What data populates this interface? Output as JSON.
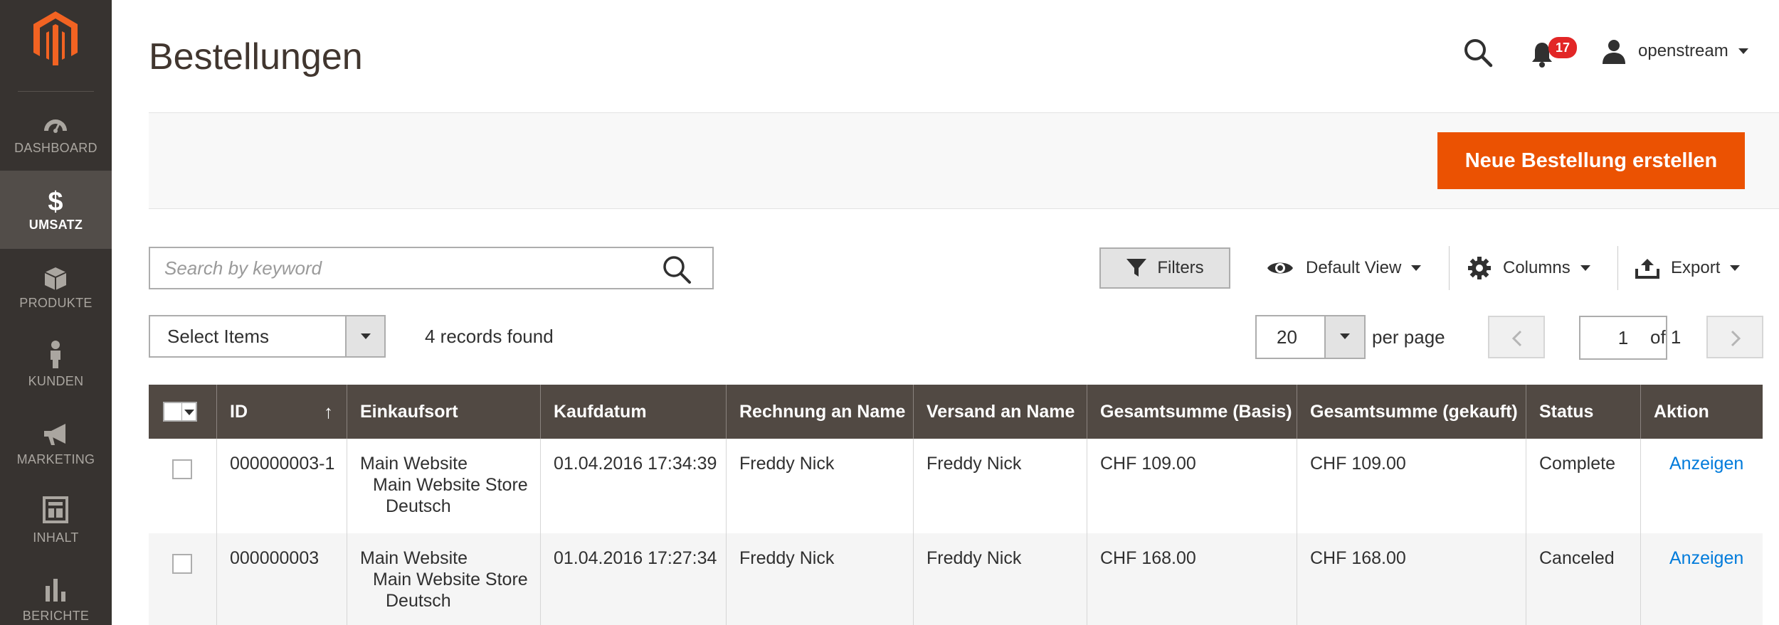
{
  "sidebar": {
    "items": [
      {
        "label": "DASHBOARD",
        "icon": "dashboard-icon"
      },
      {
        "label": "UMSATZ",
        "icon": "dollar-icon",
        "active": true
      },
      {
        "label": "PRODUKTE",
        "icon": "box-icon"
      },
      {
        "label": "KUNDEN",
        "icon": "person-icon"
      },
      {
        "label": "MARKETING",
        "icon": "megaphone-icon"
      },
      {
        "label": "INHALT",
        "icon": "layout-icon"
      },
      {
        "label": "BERICHTE",
        "icon": "bar-chart-icon"
      }
    ]
  },
  "header": {
    "title": "Bestellungen",
    "notifications_count": "17",
    "user_name": "openstream"
  },
  "actions": {
    "primary_label": "Neue Bestellung erstellen"
  },
  "toolbar": {
    "search_placeholder": "Search by keyword",
    "filters_label": "Filters",
    "view_label": "Default View",
    "columns_label": "Columns",
    "export_label": "Export",
    "mass_action_label": "Select Items",
    "records_found": "4 records found",
    "per_page_value": "20",
    "per_page_label": "per page",
    "current_page": "1",
    "page_of": "of 1"
  },
  "grid": {
    "columns": [
      "ID",
      "Einkaufsort",
      "Kaufdatum",
      "Rechnung an Name",
      "Versand an Name",
      "Gesamtsumme (Basis)",
      "Gesamtsumme (gekauft)",
      "Status",
      "Aktion"
    ],
    "rows": [
      {
        "id": "000000003-1",
        "store": [
          "Main Website",
          "Main Website Store",
          "Deutsch"
        ],
        "date": "01.04.2016 17:34:39",
        "bill_to": "Freddy Nick",
        "ship_to": "Freddy Nick",
        "total_base": "CHF 109.00",
        "total_purchased": "CHF 109.00",
        "status": "Complete",
        "action": "Anzeigen"
      },
      {
        "id": "000000003",
        "store": [
          "Main Website",
          "Main Website Store",
          "Deutsch"
        ],
        "date": "01.04.2016 17:27:34",
        "bill_to": "Freddy Nick",
        "ship_to": "Freddy Nick",
        "total_base": "CHF 168.00",
        "total_purchased": "CHF 168.00",
        "status": "Canceled",
        "action": "Anzeigen"
      }
    ]
  },
  "colors": {
    "sidebar_bg": "#373330",
    "sidebar_active": "#524d49",
    "brand_orange": "#eb5202",
    "table_header": "#514943",
    "link": "#007bdb",
    "badge": "#e22626"
  }
}
